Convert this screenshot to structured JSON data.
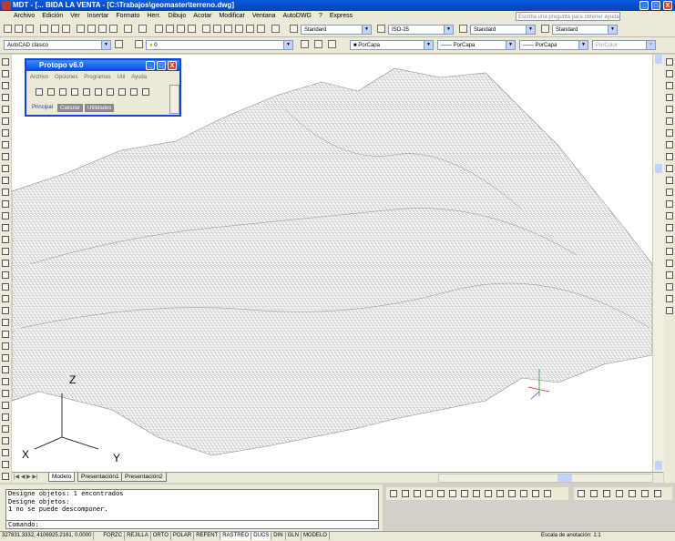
{
  "window": {
    "title": "MDT - [... BIDA LA VENTA - [C:\\Trabajos\\geomaster\\terreno.dwg]",
    "controls": [
      "_",
      "□",
      "X"
    ]
  },
  "menu": {
    "items": [
      "Archivo",
      "Edición",
      "Ver",
      "Insertar",
      "Formato",
      "Herr.",
      "Dibujo",
      "Acotar",
      "Modificar",
      "Ventana",
      "AutoDWG",
      "?",
      "Express"
    ],
    "help_placeholder": "Escriba una pregunta para obtener ayuda"
  },
  "toolbars": {
    "text_style": "Standard",
    "dim_style": "ISO-25",
    "table_style": "Standard",
    "plot_style": "Standard",
    "workspace": "AutoCAD clásico",
    "layer": "0",
    "color": "PorCapa",
    "linetype": "PorCapa",
    "lineweight": "PorCapa",
    "plotcolor": "PorColor"
  },
  "protopo": {
    "title": "Protopo v6.0",
    "menu": [
      "Archivo",
      "Opciones",
      "Programas",
      "Util",
      "Ayuda"
    ],
    "tabs": [
      "Principal",
      "Calcular",
      "Utilidades"
    ]
  },
  "ucs": {
    "x": "X",
    "y": "Y",
    "z": "Z"
  },
  "layout_tabs": [
    "Modelo",
    "Presentación1",
    "Presentación2"
  ],
  "command": {
    "lines": [
      "Designe objetos: 1 encontrados",
      "Designe objetos:",
      "1 no se puede descomponer."
    ],
    "prompt": "Comando:"
  },
  "status": {
    "coords": "327831.3332, 4106925.2161, 0.0000",
    "toggles": [
      "FORZC",
      "REJILLA",
      "ORTO",
      "POLAR",
      "REFENT",
      "RASTREO",
      "DUCS",
      "DIN",
      "GLN",
      "MODELO"
    ],
    "annotation_scale": "Escala de anotación: 1:1"
  },
  "colors": {
    "title_blue": "#0a46d8",
    "mesh": "#9a9a9a",
    "accent_red": "#e02020",
    "accent_green": "#20a020"
  }
}
